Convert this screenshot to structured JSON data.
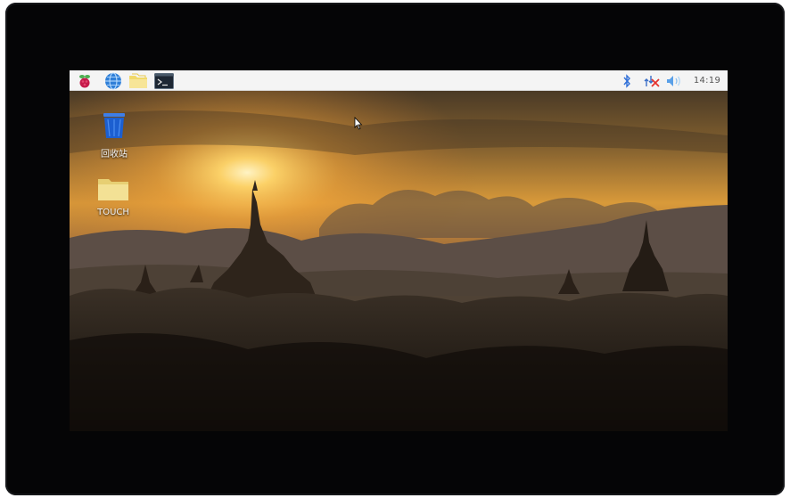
{
  "taskbar": {
    "launchers": [
      {
        "icon": "raspberry-menu-icon"
      },
      {
        "icon": "web-browser-icon"
      },
      {
        "icon": "file-manager-icon"
      },
      {
        "icon": "terminal-icon"
      }
    ],
    "tray": {
      "bluetooth_icon": "bluetooth-icon",
      "network_icon": "network-disconnected-icon",
      "volume_icon": "volume-icon",
      "clock": "14:19"
    }
  },
  "desktop": {
    "icons": [
      {
        "label": "回收站",
        "icon": "trash-icon"
      },
      {
        "label": "TOUCH",
        "icon": "folder-icon"
      }
    ]
  },
  "colors": {
    "bezel": "#050506",
    "taskbar": "#f4f4f4",
    "sky_glow": "#f6b13a",
    "trash_blue": "#1c5fd0",
    "folder_yellow": "#f1dd86"
  }
}
